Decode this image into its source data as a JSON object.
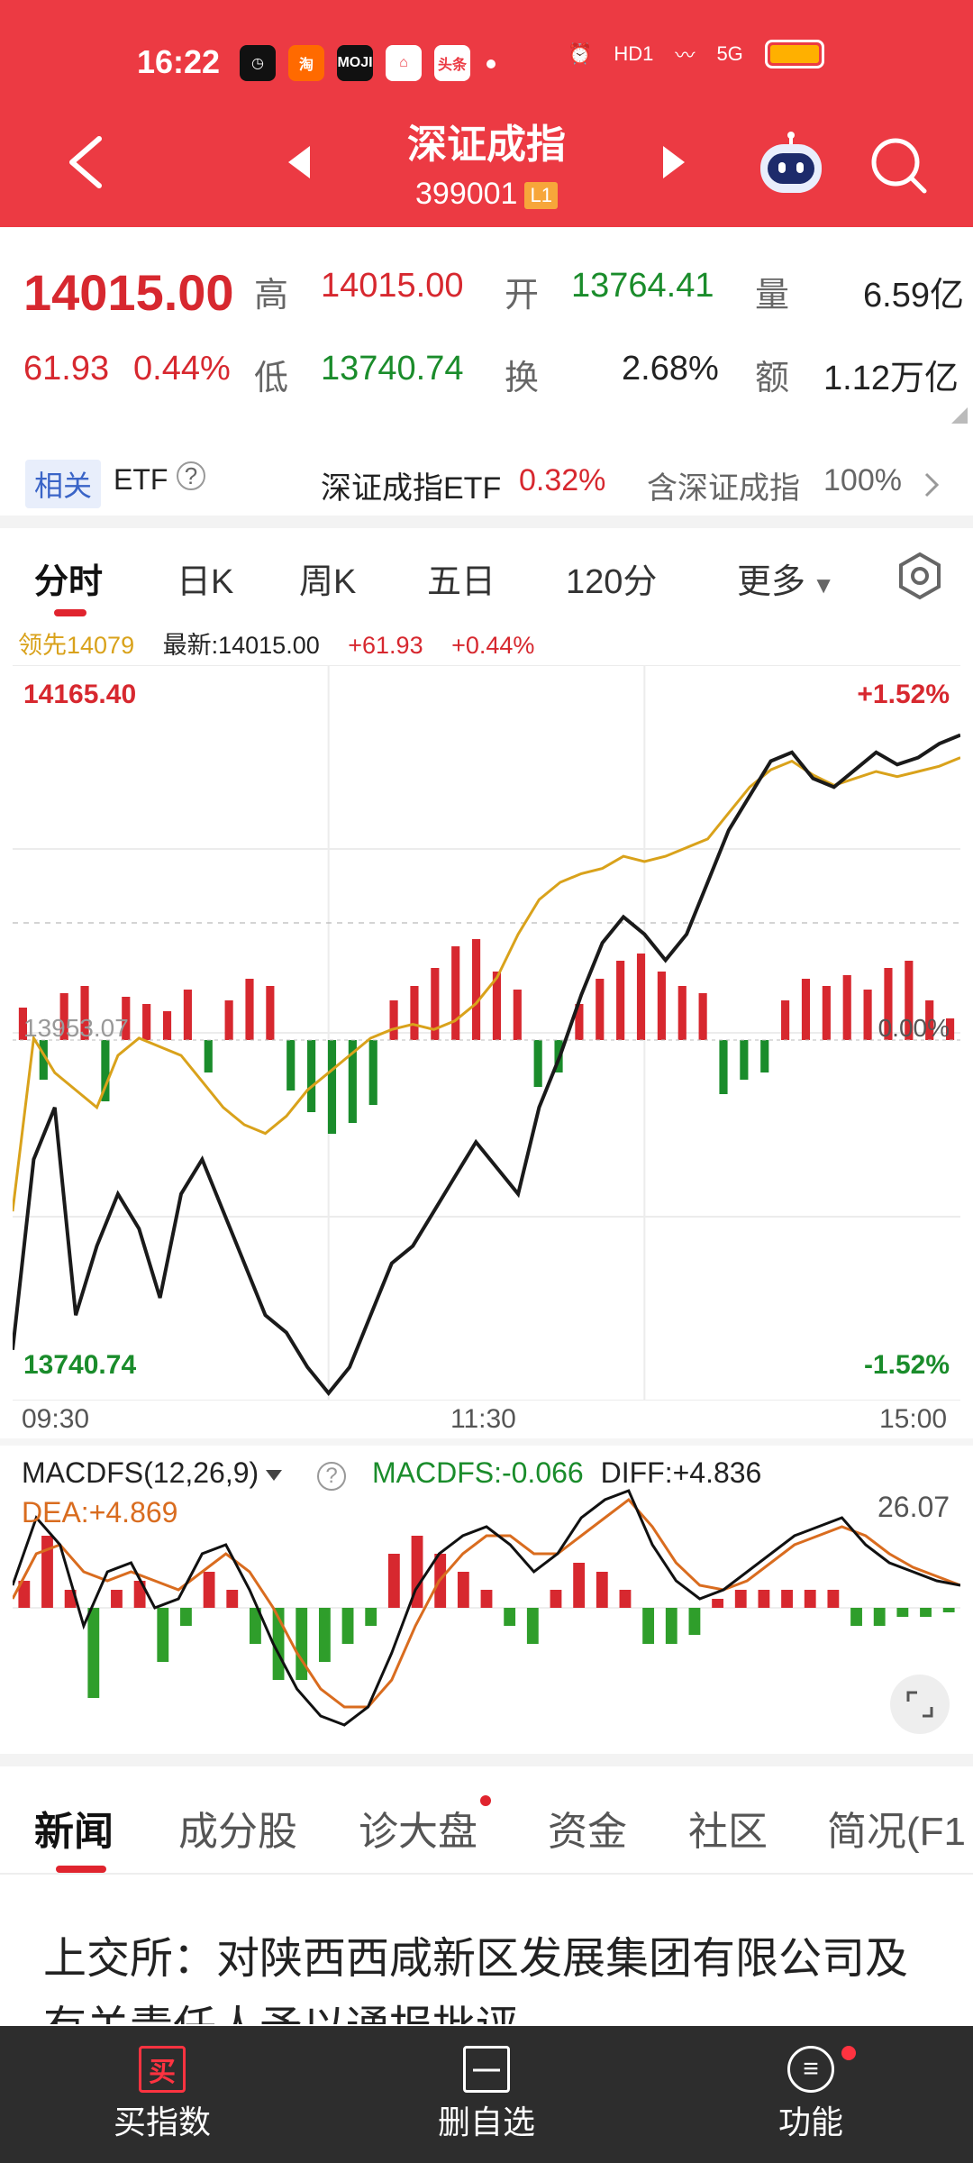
{
  "status_bar": {
    "time": "16:22",
    "app_icons": [
      "clock-app",
      "淘",
      "MOJI",
      "home-app",
      "头条"
    ],
    "network": "5G",
    "hd": "HD1"
  },
  "header": {
    "title": "深证成指",
    "code": "399001",
    "level": "L1"
  },
  "quote": {
    "price": "14015.00",
    "change": "61.93",
    "change_pct": "0.44%",
    "high_label": "高",
    "high": "14015.00",
    "low_label": "低",
    "low": "13740.74",
    "open_label": "开",
    "open": "13764.41",
    "turnover_label": "换",
    "turnover": "2.68%",
    "volume_label": "量",
    "volume": "6.59亿",
    "amount_label": "额",
    "amount": "1.12万亿"
  },
  "etf": {
    "tag": "相关",
    "label": "ETF",
    "name": "深证成指ETF",
    "pct": "0.32%",
    "contain_label": "含深证成指",
    "contain_pct": "100%"
  },
  "chart_tabs": [
    "分时",
    "日K",
    "周K",
    "五日",
    "120分",
    "更多"
  ],
  "info_line": {
    "leader": "领先14079",
    "latest": "最新:14015.00",
    "change": "+61.93",
    "pct": "+0.44%"
  },
  "chart_data": {
    "type": "line",
    "y_max_label": "14165.40",
    "y_min_label": "13740.74",
    "pct_max_label": "+1.52%",
    "pct_min_label": "-1.52%",
    "pct_zero_label": "0.00%",
    "prev_close_label": "13953.07",
    "ylim": [
      13740.74,
      14165.4
    ],
    "x_ticks": [
      "09:30",
      "11:30",
      "15:00"
    ],
    "series": [
      {
        "name": "最新",
        "color": "#1a1a1a",
        "values": [
          13770,
          13880,
          13910,
          13790,
          13830,
          13860,
          13840,
          13800,
          13860,
          13880,
          13850,
          13820,
          13790,
          13780,
          13760,
          13745,
          13760,
          13790,
          13820,
          13830,
          13850,
          13870,
          13890,
          13875,
          13860,
          13910,
          13940,
          13975,
          14005,
          14020,
          14010,
          13995,
          14010,
          14040,
          14070,
          14090,
          14110,
          14115,
          14100,
          14095,
          14105,
          14115,
          14108,
          14112,
          14120,
          14125
        ]
      },
      {
        "name": "领先",
        "color": "#d9a21b",
        "values": [
          13850,
          13950,
          13930,
          13920,
          13910,
          13940,
          13950,
          13945,
          13940,
          13925,
          13910,
          13900,
          13895,
          13905,
          13920,
          13930,
          13940,
          13950,
          13955,
          13958,
          13955,
          13960,
          13970,
          13985,
          14010,
          14030,
          14040,
          14045,
          14048,
          14055,
          14052,
          14055,
          14060,
          14065,
          14080,
          14095,
          14105,
          14110,
          14102,
          14096,
          14100,
          14104,
          14101,
          14104,
          14107,
          14112
        ]
      }
    ],
    "volume_bars": [
      18,
      -22,
      26,
      30,
      -34,
      24,
      20,
      16,
      28,
      -18,
      22,
      34,
      30,
      -28,
      -40,
      -52,
      -46,
      -36,
      22,
      30,
      40,
      52,
      56,
      38,
      28,
      -26,
      -18,
      20,
      34,
      44,
      48,
      38,
      30,
      26,
      -30,
      -22,
      -18,
      22,
      34,
      30,
      36,
      28,
      40,
      44,
      22,
      12
    ]
  },
  "macd": {
    "title": "MACDFS(12,26,9)",
    "macdfs": "MACDFS:-0.066",
    "diff": "DIFF:+4.836",
    "dea": "DEA:+4.869",
    "max_label": "26.07",
    "chart_data": {
      "type": "line",
      "series": [
        {
          "name": "DIFF",
          "color": "#111111",
          "values": [
            5,
            20,
            14,
            -4,
            8,
            10,
            0,
            2,
            12,
            14,
            4,
            -8,
            -18,
            -24,
            -26,
            -22,
            -10,
            4,
            12,
            16,
            18,
            14,
            8,
            12,
            20,
            24,
            26,
            14,
            6,
            2,
            4,
            8,
            12,
            16,
            18,
            20,
            14,
            10,
            8,
            6,
            5
          ]
        },
        {
          "name": "DEA",
          "color": "#d96c1f",
          "values": [
            2,
            12,
            14,
            8,
            6,
            8,
            6,
            4,
            8,
            12,
            8,
            0,
            -10,
            -18,
            -22,
            -22,
            -16,
            -4,
            6,
            12,
            16,
            16,
            12,
            12,
            16,
            20,
            24,
            18,
            10,
            5,
            4,
            6,
            10,
            14,
            16,
            18,
            16,
            12,
            9,
            7,
            5
          ]
        }
      ],
      "bars": [
        6,
        16,
        4,
        -20,
        4,
        6,
        -12,
        -4,
        8,
        4,
        -8,
        -16,
        -16,
        -12,
        -8,
        -4,
        12,
        16,
        12,
        8,
        4,
        -4,
        -8,
        4,
        10,
        8,
        4,
        -8,
        -8,
        -6,
        2,
        4,
        4,
        4,
        4,
        4,
        -4,
        -4,
        -2,
        -2,
        -1
      ]
    }
  },
  "bottom_tabs": [
    "新闻",
    "成分股",
    "诊大盘",
    "资金",
    "社区",
    "简况(F1"
  ],
  "news_headline": "上交所：对陕西西咸新区发展集团有限公司及有关责任人予以通报批评",
  "bottom_bar": {
    "buy_label": "买指数",
    "buy_icon_text": "买",
    "remove_label": "删自选",
    "func_label": "功能"
  }
}
